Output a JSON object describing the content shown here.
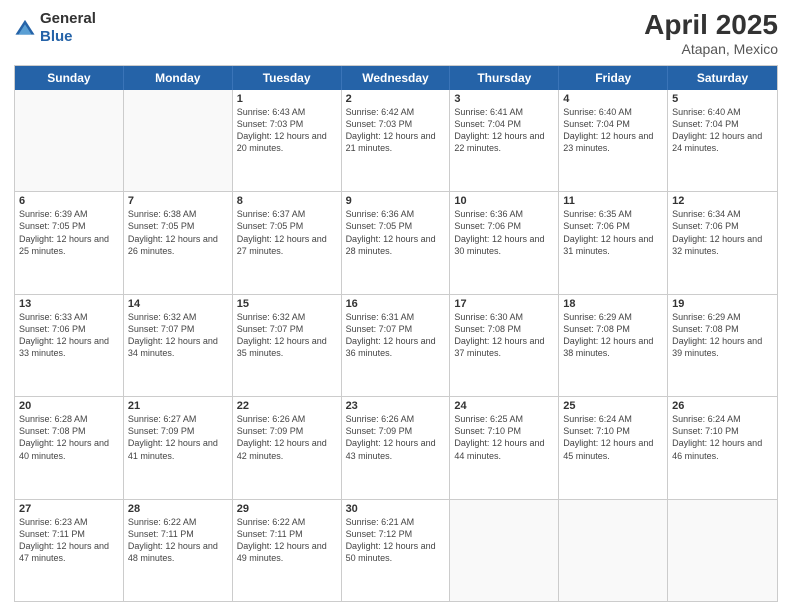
{
  "logo": {
    "general": "General",
    "blue": "Blue"
  },
  "title": {
    "month": "April 2025",
    "location": "Atapan, Mexico"
  },
  "header_days": [
    "Sunday",
    "Monday",
    "Tuesday",
    "Wednesday",
    "Thursday",
    "Friday",
    "Saturday"
  ],
  "rows": [
    [
      {
        "day": "",
        "info": ""
      },
      {
        "day": "",
        "info": ""
      },
      {
        "day": "1",
        "info": "Sunrise: 6:43 AM\nSunset: 7:03 PM\nDaylight: 12 hours and 20 minutes."
      },
      {
        "day": "2",
        "info": "Sunrise: 6:42 AM\nSunset: 7:03 PM\nDaylight: 12 hours and 21 minutes."
      },
      {
        "day": "3",
        "info": "Sunrise: 6:41 AM\nSunset: 7:04 PM\nDaylight: 12 hours and 22 minutes."
      },
      {
        "day": "4",
        "info": "Sunrise: 6:40 AM\nSunset: 7:04 PM\nDaylight: 12 hours and 23 minutes."
      },
      {
        "day": "5",
        "info": "Sunrise: 6:40 AM\nSunset: 7:04 PM\nDaylight: 12 hours and 24 minutes."
      }
    ],
    [
      {
        "day": "6",
        "info": "Sunrise: 6:39 AM\nSunset: 7:05 PM\nDaylight: 12 hours and 25 minutes."
      },
      {
        "day": "7",
        "info": "Sunrise: 6:38 AM\nSunset: 7:05 PM\nDaylight: 12 hours and 26 minutes."
      },
      {
        "day": "8",
        "info": "Sunrise: 6:37 AM\nSunset: 7:05 PM\nDaylight: 12 hours and 27 minutes."
      },
      {
        "day": "9",
        "info": "Sunrise: 6:36 AM\nSunset: 7:05 PM\nDaylight: 12 hours and 28 minutes."
      },
      {
        "day": "10",
        "info": "Sunrise: 6:36 AM\nSunset: 7:06 PM\nDaylight: 12 hours and 30 minutes."
      },
      {
        "day": "11",
        "info": "Sunrise: 6:35 AM\nSunset: 7:06 PM\nDaylight: 12 hours and 31 minutes."
      },
      {
        "day": "12",
        "info": "Sunrise: 6:34 AM\nSunset: 7:06 PM\nDaylight: 12 hours and 32 minutes."
      }
    ],
    [
      {
        "day": "13",
        "info": "Sunrise: 6:33 AM\nSunset: 7:06 PM\nDaylight: 12 hours and 33 minutes."
      },
      {
        "day": "14",
        "info": "Sunrise: 6:32 AM\nSunset: 7:07 PM\nDaylight: 12 hours and 34 minutes."
      },
      {
        "day": "15",
        "info": "Sunrise: 6:32 AM\nSunset: 7:07 PM\nDaylight: 12 hours and 35 minutes."
      },
      {
        "day": "16",
        "info": "Sunrise: 6:31 AM\nSunset: 7:07 PM\nDaylight: 12 hours and 36 minutes."
      },
      {
        "day": "17",
        "info": "Sunrise: 6:30 AM\nSunset: 7:08 PM\nDaylight: 12 hours and 37 minutes."
      },
      {
        "day": "18",
        "info": "Sunrise: 6:29 AM\nSunset: 7:08 PM\nDaylight: 12 hours and 38 minutes."
      },
      {
        "day": "19",
        "info": "Sunrise: 6:29 AM\nSunset: 7:08 PM\nDaylight: 12 hours and 39 minutes."
      }
    ],
    [
      {
        "day": "20",
        "info": "Sunrise: 6:28 AM\nSunset: 7:08 PM\nDaylight: 12 hours and 40 minutes."
      },
      {
        "day": "21",
        "info": "Sunrise: 6:27 AM\nSunset: 7:09 PM\nDaylight: 12 hours and 41 minutes."
      },
      {
        "day": "22",
        "info": "Sunrise: 6:26 AM\nSunset: 7:09 PM\nDaylight: 12 hours and 42 minutes."
      },
      {
        "day": "23",
        "info": "Sunrise: 6:26 AM\nSunset: 7:09 PM\nDaylight: 12 hours and 43 minutes."
      },
      {
        "day": "24",
        "info": "Sunrise: 6:25 AM\nSunset: 7:10 PM\nDaylight: 12 hours and 44 minutes."
      },
      {
        "day": "25",
        "info": "Sunrise: 6:24 AM\nSunset: 7:10 PM\nDaylight: 12 hours and 45 minutes."
      },
      {
        "day": "26",
        "info": "Sunrise: 6:24 AM\nSunset: 7:10 PM\nDaylight: 12 hours and 46 minutes."
      }
    ],
    [
      {
        "day": "27",
        "info": "Sunrise: 6:23 AM\nSunset: 7:11 PM\nDaylight: 12 hours and 47 minutes."
      },
      {
        "day": "28",
        "info": "Sunrise: 6:22 AM\nSunset: 7:11 PM\nDaylight: 12 hours and 48 minutes."
      },
      {
        "day": "29",
        "info": "Sunrise: 6:22 AM\nSunset: 7:11 PM\nDaylight: 12 hours and 49 minutes."
      },
      {
        "day": "30",
        "info": "Sunrise: 6:21 AM\nSunset: 7:12 PM\nDaylight: 12 hours and 50 minutes."
      },
      {
        "day": "",
        "info": ""
      },
      {
        "day": "",
        "info": ""
      },
      {
        "day": "",
        "info": ""
      }
    ]
  ]
}
